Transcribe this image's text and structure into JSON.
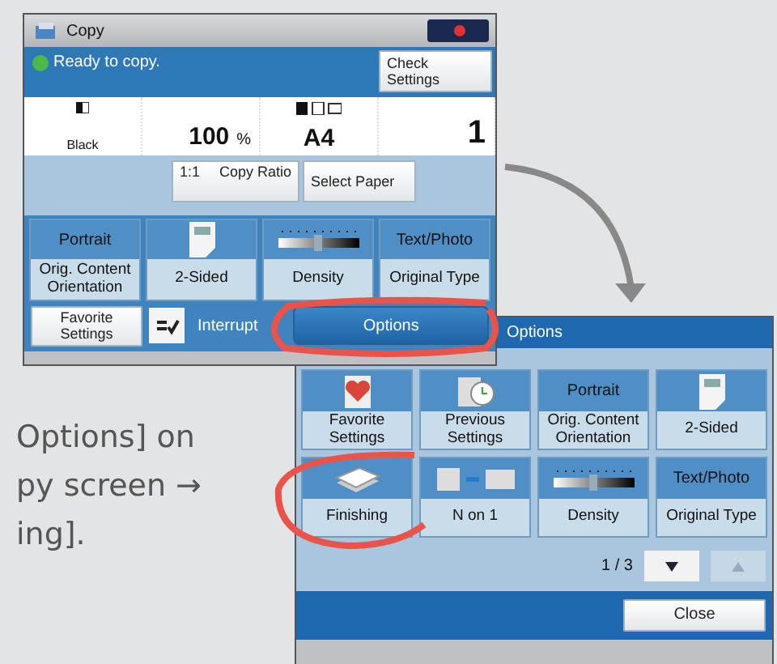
{
  "copy_screen": {
    "title": "Copy",
    "status": "Ready to copy.",
    "check_settings": "Check Settings",
    "info": {
      "color_mode": "Black",
      "ratio": "100",
      "ratio_unit": "%",
      "paper": "A4",
      "copies": "1"
    },
    "ratio_buttons": [
      {
        "label": "1:1"
      },
      {
        "label": "Copy Ratio"
      }
    ],
    "select_paper": "Select Paper",
    "tiles": [
      {
        "kind": "text",
        "top": "Portrait",
        "label": "Orig. Content Orientation"
      },
      {
        "kind": "page",
        "label": "2-Sided"
      },
      {
        "kind": "slider",
        "label": "Density"
      },
      {
        "kind": "text",
        "top": "Text/Photo",
        "label": "Original Type"
      }
    ],
    "favorite": "Favorite Settings",
    "interrupt": "Interrupt",
    "options": "Options"
  },
  "options_screen": {
    "title": "Options",
    "tiles": [
      {
        "kind": "heart",
        "label": "Favorite Settings"
      },
      {
        "kind": "clock",
        "label": "Previous Settings"
      },
      {
        "kind": "text",
        "top": "Portrait",
        "label": "Orig. Content Orientation"
      },
      {
        "kind": "page",
        "label": "2-Sided"
      },
      {
        "kind": "stack",
        "label": "Finishing"
      },
      {
        "kind": "non1",
        "label": "N on 1"
      },
      {
        "kind": "slider",
        "label": "Density"
      },
      {
        "kind": "text",
        "top": "Text/Photo",
        "label": "Original Type"
      }
    ],
    "page": "1 / 3",
    "close": "Close"
  },
  "caption": [
    "Options] on",
    "py screen →",
    "ing]."
  ]
}
